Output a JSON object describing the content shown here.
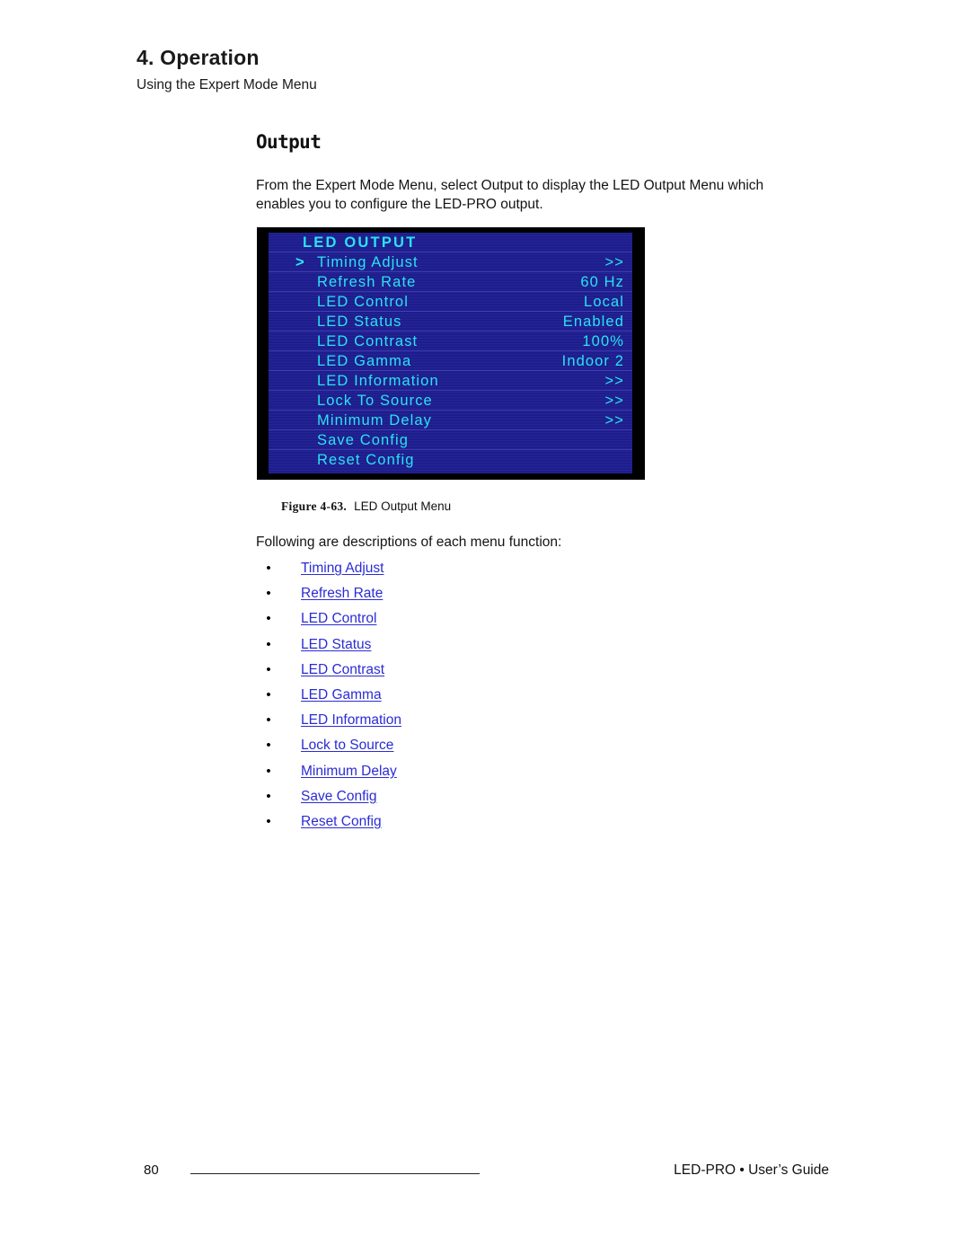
{
  "header": {
    "chapter": "4.  Operation",
    "subtitle": "Using the Expert Mode Menu"
  },
  "section": {
    "title": "Output",
    "body": "From the Expert Mode Menu, select Output to display the LED Output Menu which enables you to configure the LED-PRO output."
  },
  "led_menu": {
    "title": "LED OUTPUT",
    "cursor_glyph": ">",
    "colors": {
      "background": "#1d1d8e",
      "text": "#28e2f0",
      "border": "#000000",
      "row_divider": "#3a3aae"
    },
    "rows": [
      {
        "label": "Timing Adjust",
        "value": ">>",
        "selected": true
      },
      {
        "label": "Refresh Rate",
        "value": "60 Hz",
        "selected": false
      },
      {
        "label": "LED Control",
        "value": "Local",
        "selected": false
      },
      {
        "label": "LED Status",
        "value": "Enabled",
        "selected": false
      },
      {
        "label": "LED Contrast",
        "value": "100%",
        "selected": false
      },
      {
        "label": "LED Gamma",
        "value": "Indoor 2",
        "selected": false
      },
      {
        "label": "LED Information",
        "value": ">>",
        "selected": false
      },
      {
        "label": "Lock To Source",
        "value": ">>",
        "selected": false
      },
      {
        "label": "Minimum Delay",
        "value": ">>",
        "selected": false
      },
      {
        "label": "Save Config",
        "value": "",
        "selected": false
      },
      {
        "label": "Reset Config",
        "value": "",
        "selected": false
      }
    ]
  },
  "figure": {
    "number": "Figure 4-63.",
    "caption": "LED Output Menu"
  },
  "descriptions": {
    "intro": "Following are descriptions of each menu function:",
    "bullet_glyph": "•",
    "link_color": "#2b2bd6",
    "items": [
      "Timing Adjust",
      "Refresh Rate",
      "LED Control",
      "LED Status",
      "LED Contrast",
      "LED Gamma",
      "LED Information",
      "Lock to Source",
      "Minimum Delay",
      "Save Config",
      "Reset Config"
    ]
  },
  "footer": {
    "page_number": "80",
    "right_text": "LED-PRO • User’s Guide"
  }
}
